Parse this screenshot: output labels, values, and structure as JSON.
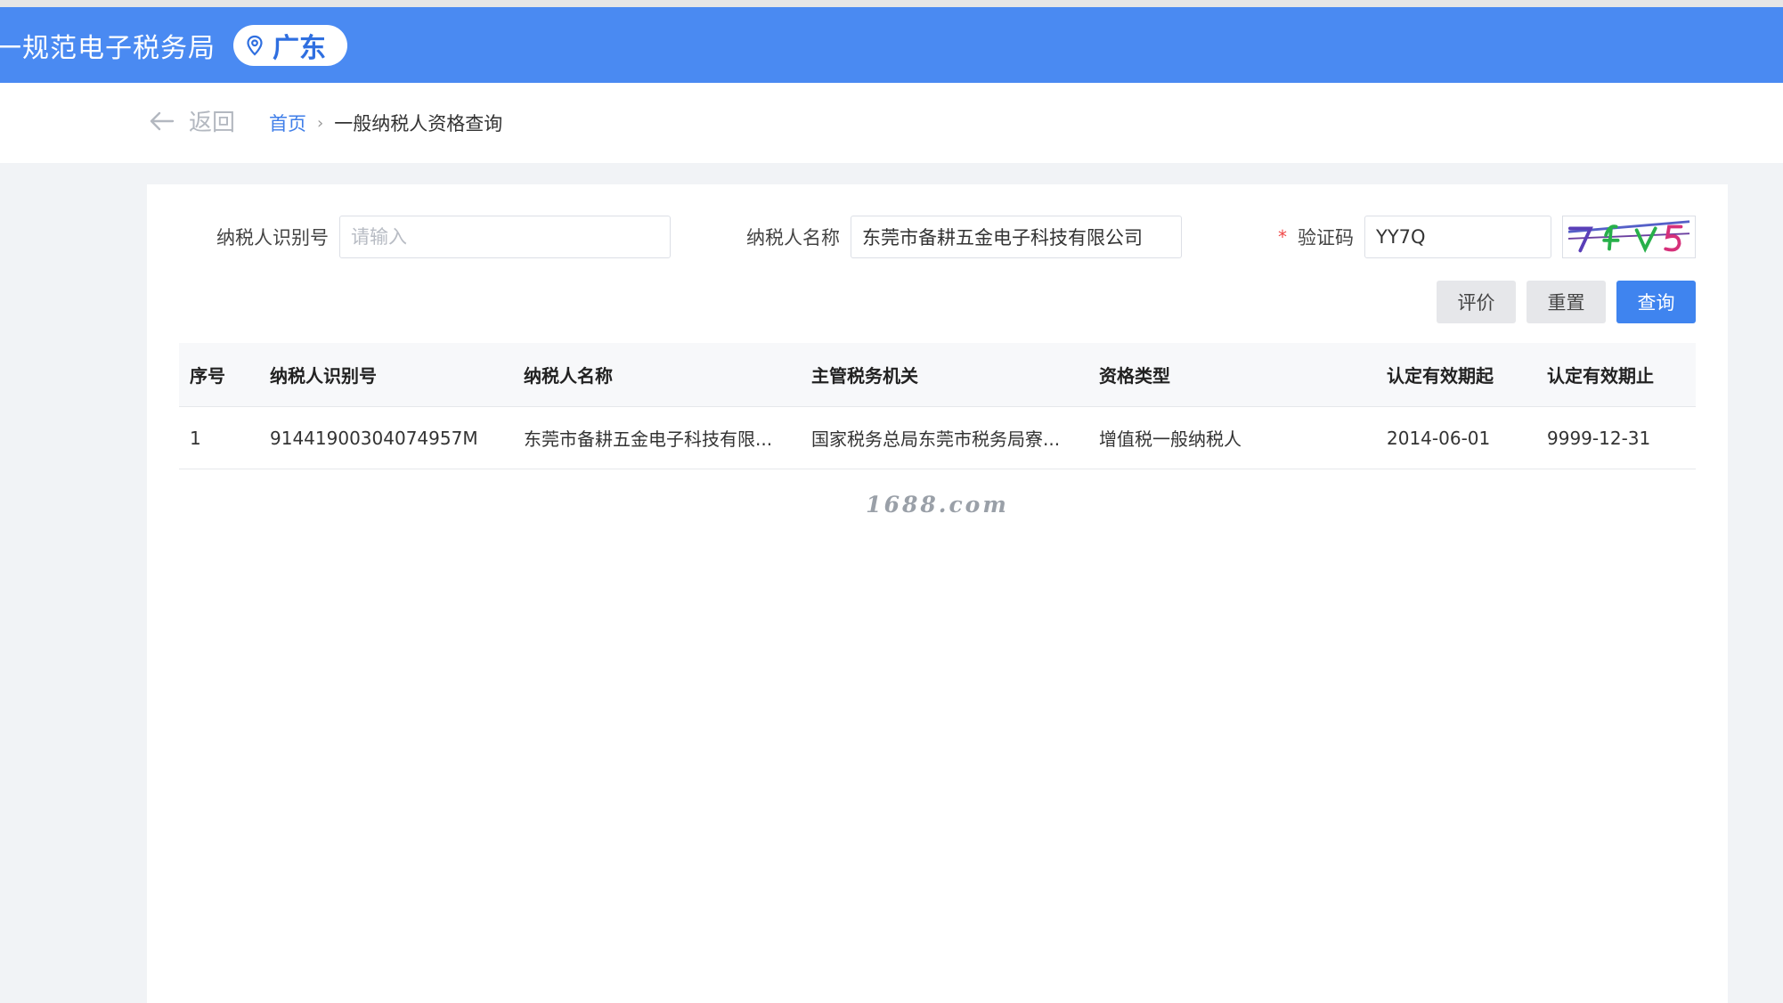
{
  "header": {
    "title": "一规范电子税务局",
    "region": "广东"
  },
  "subbar": {
    "back_label": "返回",
    "breadcrumb": {
      "home": "首页",
      "separator": "›",
      "current": "一般纳税人资格查询"
    }
  },
  "form": {
    "taxpayer_id": {
      "label": "纳税人识别号",
      "value": "",
      "placeholder": "请输入"
    },
    "taxpayer_name": {
      "label": "纳税人名称",
      "value": "东莞市备耕五金电子科技有限公司"
    },
    "captcha": {
      "required_mark": "*",
      "label": "验证码",
      "value": "YY7Q",
      "image_text": "7fv5"
    }
  },
  "buttons": {
    "evaluate": "评价",
    "reset": "重置",
    "query": "查询"
  },
  "table": {
    "headers": [
      "序号",
      "纳税人识别号",
      "纳税人名称",
      "主管税务机关",
      "资格类型",
      "认定有效期起",
      "认定有效期止"
    ],
    "rows": [
      [
        "1",
        "91441900304074957M",
        "东莞市备耕五金电子科技有限...",
        "国家税务总局东莞市税务局寮...",
        "增值税一般纳税人",
        "2014-06-01",
        "9999-12-31"
      ]
    ]
  },
  "watermark": "1688.com",
  "colors": {
    "header_bg": "#4a8af2",
    "primary_button": "#3f84ef",
    "link": "#3f7ee8"
  }
}
